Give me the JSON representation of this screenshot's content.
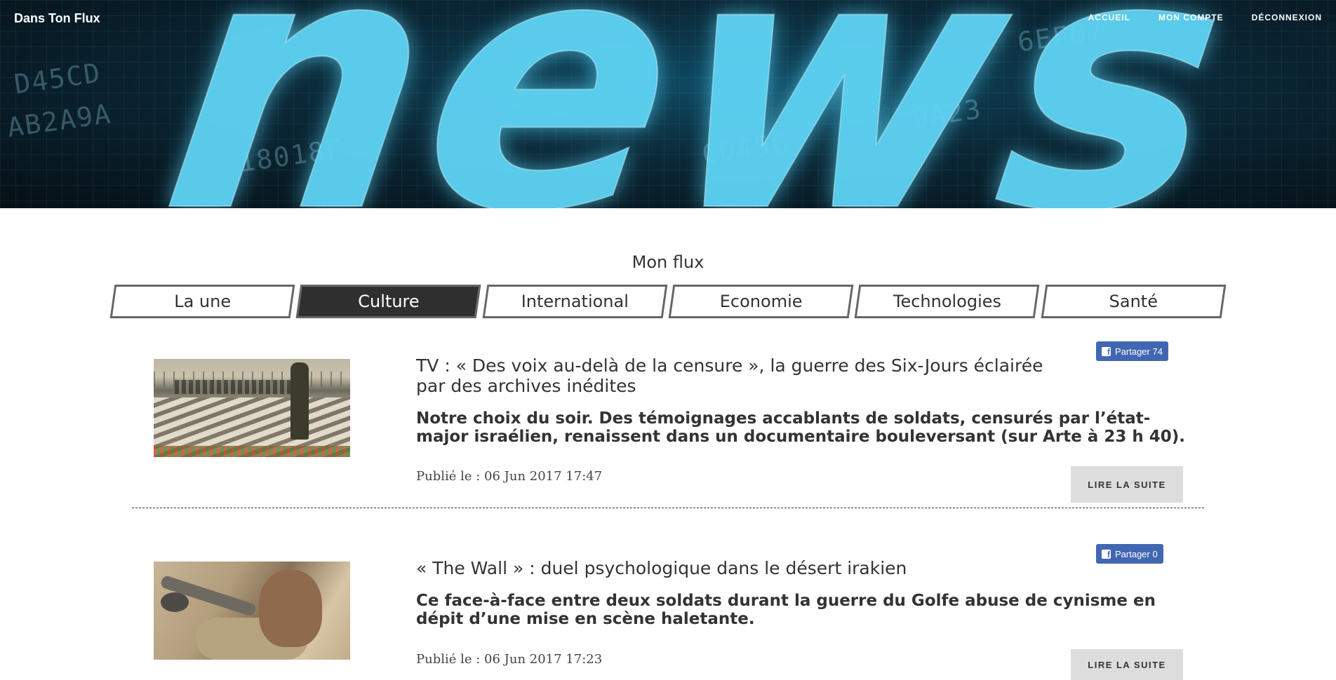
{
  "header": {
    "brand": "Dans Ton Flux",
    "hero_word": "news",
    "nav": [
      {
        "label": "ACCUEIL"
      },
      {
        "label": "MON COMPTE"
      },
      {
        "label": "DÉCONNEXION"
      }
    ]
  },
  "tabs": {
    "main": "Mon flux",
    "categories": [
      {
        "label": "La une",
        "active": false
      },
      {
        "label": "Culture",
        "active": true
      },
      {
        "label": "International",
        "active": false
      },
      {
        "label": "Economie",
        "active": false
      },
      {
        "label": "Technologies",
        "active": false
      },
      {
        "label": "Santé",
        "active": false
      }
    ]
  },
  "articles": [
    {
      "title": "TV : « Des voix au-delà de la censure », la guerre des Six-Jours éclairée par des archives inédites",
      "subtitle": "Notre choix du soir. Des témoignages accablants de soldats, censurés par l’état-major israélien, renaissent dans un documentaire bouleversant (sur Arte à 23 h 40).",
      "date": "Publié le : 06 Jun 2017 17:47",
      "share_label": "Partager 74",
      "read_more": "LIRE LA SUITE"
    },
    {
      "title": "« The Wall » : duel psychologique dans le désert irakien",
      "subtitle": "Ce face-à-face entre deux soldats durant la guerre du Golfe abuse de cynisme en dépit d’une mise en scène haletante.",
      "date": "Publié le : 06 Jun 2017 17:23",
      "share_label": "Partager 0",
      "read_more": "LIRE LA SUITE"
    }
  ],
  "colors": {
    "facebook": "#4267b2",
    "active_tab": "#2f2f2f"
  }
}
